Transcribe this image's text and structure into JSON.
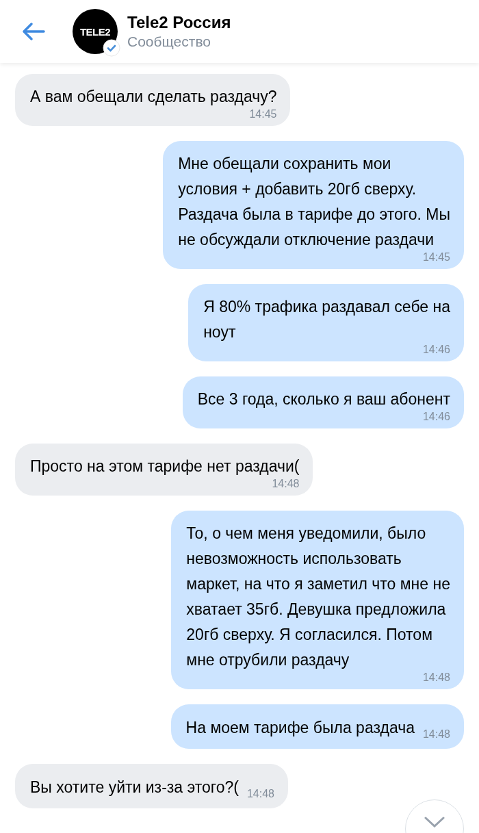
{
  "header": {
    "logo": "TELE2",
    "verified": true,
    "title": "Tele2 Россия",
    "subtitle": "Сообщество"
  },
  "messages": [
    {
      "kind": "incoming",
      "time_inline": false,
      "lines": [
        "А вам обещали сделать раздачу?"
      ],
      "time": "14:45"
    },
    {
      "kind": "outgoing",
      "time_inline": false,
      "lines": [
        "Мне обещали сохранить мои",
        "условия + добавить 20гб сверху.",
        "Раздача была в тарифе до этого. Мы",
        "не обсуждали отключение раздачи"
      ],
      "time": "14:45"
    },
    {
      "kind": "outgoing",
      "time_inline": false,
      "lines": [
        "Я 80% трафика раздавал себе на",
        "ноут"
      ],
      "time": "14:46"
    },
    {
      "kind": "outgoing",
      "time_inline": false,
      "lines": [
        "Все 3 года, сколько я ваш абонент"
      ],
      "time": "14:46"
    },
    {
      "kind": "incoming",
      "time_inline": false,
      "lines": [
        "Просто на этом тарифе нет раздачи("
      ],
      "time": "14:48"
    },
    {
      "kind": "outgoing",
      "time_inline": false,
      "lines": [
        "То, о чем меня уведомили, было",
        "невозможность использовать",
        "маркет, на что я заметил что мне не",
        "хватает 35гб. Девушка предложила",
        "20гб сверху. Я согласился. Потом",
        "мне отрубили раздачу"
      ],
      "time": "14:48"
    },
    {
      "kind": "outgoing",
      "time_inline": true,
      "lines": [
        "На моем тарифе была раздача"
      ],
      "time": "14:48"
    },
    {
      "kind": "incoming",
      "time_inline": true,
      "lines": [
        "Вы хотите уйти из-за этого?("
      ],
      "time": "14:48"
    }
  ]
}
